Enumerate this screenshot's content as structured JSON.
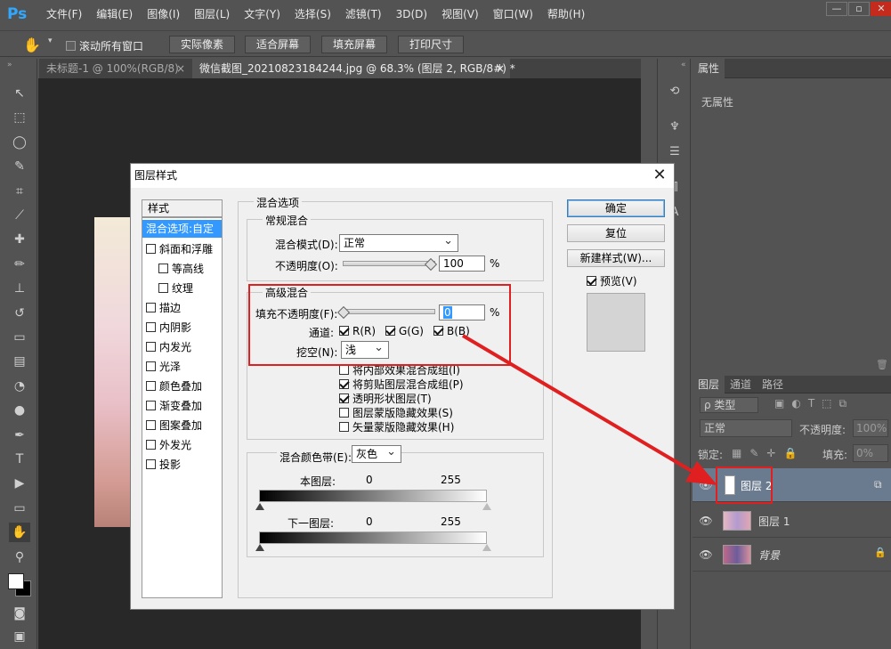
{
  "app": {
    "logo": "Ps",
    "menu": [
      "文件(F)",
      "编辑(E)",
      "图像(I)",
      "图层(L)",
      "文字(Y)",
      "选择(S)",
      "滤镜(T)",
      "3D(D)",
      "视图(V)",
      "窗口(W)",
      "帮助(H)"
    ],
    "window_controls": [
      "—",
      "▫",
      "✕"
    ]
  },
  "options_bar": {
    "scroll_all_label": "滚动所有窗口",
    "buttons": [
      "实际像素",
      "适合屏幕",
      "填充屏幕",
      "打印尺寸"
    ]
  },
  "tabs": [
    {
      "label": "未标题-1 @ 100%(RGB/8)",
      "close": "×"
    },
    {
      "label": "微信截图_20210823184244.jpg @ 68.3% (图层 2, RGB/8#) *",
      "close": "×"
    }
  ],
  "tools": [
    "move-icon",
    "marquee-icon",
    "lasso-icon",
    "quick-select-icon",
    "crop-icon",
    "eyedropper-icon",
    "healing-icon",
    "brush-icon",
    "stamp-icon",
    "history-brush-icon",
    "eraser-icon",
    "gradient-icon",
    "blur-icon",
    "dodge-icon",
    "pen-icon",
    "type-icon",
    "path-select-icon",
    "shape-icon",
    "hand-icon",
    "zoom-icon"
  ],
  "properties": {
    "tab": "属性",
    "empty": "无属性"
  },
  "layers_panel": {
    "tabs": [
      "图层",
      "通道",
      "路径"
    ],
    "filter_label": "ρ 类型",
    "blend_mode": "正常",
    "opacity_label": "不透明度:",
    "opacity_value": "100%",
    "lock_label": "锁定:",
    "fill_label": "填充:",
    "fill_value": "0%",
    "layers": [
      {
        "name": "图层 2",
        "selected": true
      },
      {
        "name": "图层 1",
        "selected": false
      },
      {
        "name": "背景",
        "selected": false
      }
    ]
  },
  "dialog": {
    "title": "图层样式",
    "close": "✕",
    "styles_header": "样式",
    "styles": [
      {
        "label": "混合选项:自定",
        "checkbox": false,
        "active": true
      },
      {
        "label": "斜面和浮雕",
        "checkbox": true
      },
      {
        "label": "等高线",
        "checkbox": true,
        "indent": true
      },
      {
        "label": "纹理",
        "checkbox": true,
        "indent": true
      },
      {
        "label": "描边",
        "checkbox": true
      },
      {
        "label": "内阴影",
        "checkbox": true
      },
      {
        "label": "内发光",
        "checkbox": true
      },
      {
        "label": "光泽",
        "checkbox": true
      },
      {
        "label": "颜色叠加",
        "checkbox": true
      },
      {
        "label": "渐变叠加",
        "checkbox": true
      },
      {
        "label": "图案叠加",
        "checkbox": true
      },
      {
        "label": "外发光",
        "checkbox": true
      },
      {
        "label": "投影",
        "checkbox": true
      }
    ],
    "blend_options_title": "混合选项",
    "general_blending": {
      "title": "常规混合",
      "mode_label": "混合模式(D):",
      "mode_value": "正常",
      "opacity_label": "不透明度(O):",
      "opacity_value": "100",
      "percent": "%"
    },
    "advanced_blending": {
      "title": "高级混合",
      "fill_label": "填充不透明度(F):",
      "fill_value": "0",
      "percent": "%",
      "channels_label": "通道:",
      "channels": [
        "R(R)",
        "G(G)",
        "B(B)"
      ],
      "knockout_label": "挖空(N):",
      "knockout_value": "浅",
      "options": [
        {
          "label": "将内部效果混合成组(I)",
          "checked": false
        },
        {
          "label": "将剪贴图层混合成组(P)",
          "checked": true
        },
        {
          "label": "透明形状图层(T)",
          "checked": true
        },
        {
          "label": "图层蒙版隐藏效果(S)",
          "checked": false
        },
        {
          "label": "矢量蒙版隐藏效果(H)",
          "checked": false
        }
      ]
    },
    "blend_if": {
      "label": "混合颜色带(E):",
      "value": "灰色",
      "this_layer": "本图层:",
      "underlying": "下一图层:",
      "low": "0",
      "high": "255"
    },
    "buttons": {
      "ok": "确定",
      "reset": "复位",
      "new_style": "新建样式(W)...",
      "preview": "预览(V)"
    }
  },
  "colors": {
    "annotation_red": "#e02020",
    "ps_bg": "#535353",
    "selection_blue": "#3399ff"
  }
}
